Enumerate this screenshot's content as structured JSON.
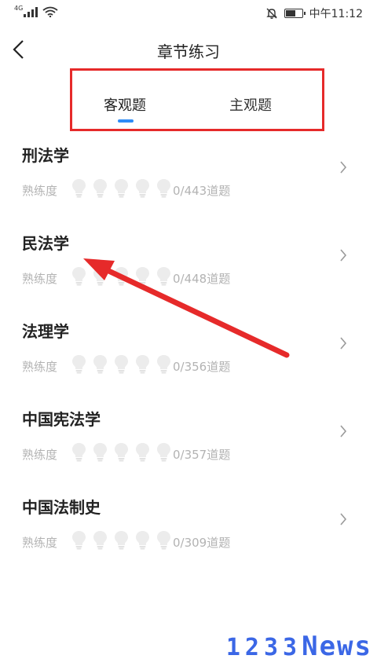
{
  "status_bar": {
    "network_label": "4G",
    "time": "中午11:12",
    "icons": [
      "signal-icon",
      "wifi-icon",
      "mute-bell-icon",
      "battery-icon"
    ],
    "battery_level": 0.7
  },
  "header": {
    "title": "章节练习",
    "back_icon": "back-arrow-icon"
  },
  "tabs": [
    {
      "label": "客观题",
      "active": true
    },
    {
      "label": "主观题",
      "active": false
    }
  ],
  "chapters": [
    {
      "title": "刑法学",
      "proficiency_label": "熟练度",
      "progress": "0/443道题"
    },
    {
      "title": "民法学",
      "proficiency_label": "熟练度",
      "progress": "0/448道题"
    },
    {
      "title": "法理学",
      "proficiency_label": "熟练度",
      "progress": "0/356道题"
    },
    {
      "title": "中国宪法学",
      "proficiency_label": "熟练度",
      "progress": "0/357道题"
    },
    {
      "title": "中国法制史",
      "proficiency_label": "熟练度",
      "progress": "0/309道题"
    }
  ],
  "watermark": {
    "digits": "1233",
    "text": "News"
  },
  "colors": {
    "accent": "#2f8cf6",
    "annotation_red": "#e62a2a",
    "watermark_blue": "#3b67e6",
    "muted_text": "#b3b3b3"
  }
}
